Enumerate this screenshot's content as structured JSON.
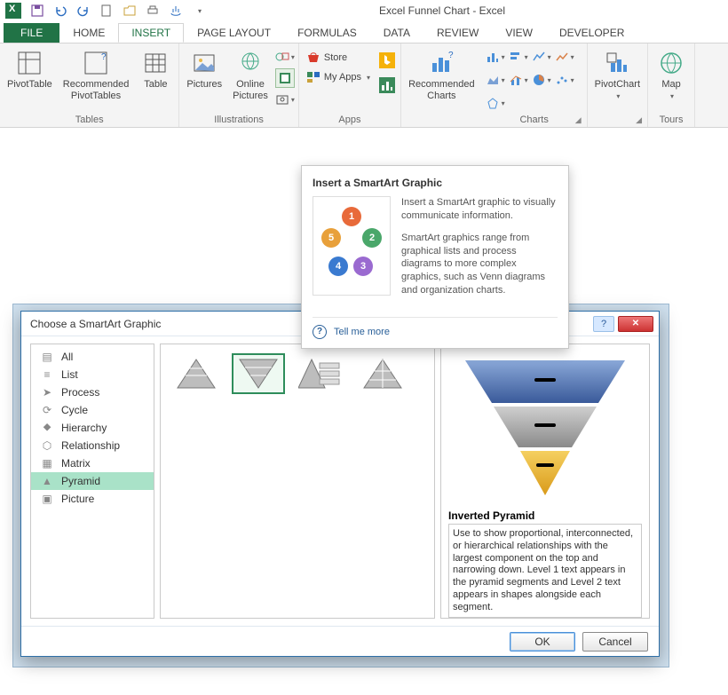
{
  "window": {
    "title": "Excel Funnel Chart - Excel"
  },
  "qat_icons": [
    "excel-logo",
    "save",
    "undo",
    "redo",
    "new",
    "open",
    "print",
    "touch",
    "customize"
  ],
  "tabs": [
    "FILE",
    "HOME",
    "INSERT",
    "PAGE LAYOUT",
    "FORMULAS",
    "DATA",
    "REVIEW",
    "VIEW",
    "DEVELOPER"
  ],
  "active_tab": "INSERT",
  "ribbon": {
    "groups": [
      {
        "name": "Tables",
        "items": [
          "PivotTable",
          "Recommended\nPivotTables",
          "Table"
        ]
      },
      {
        "name": "Illustrations",
        "items": [
          "Pictures",
          "Online\nPictures"
        ],
        "minis": [
          "shapes",
          "smartart",
          "screenshot"
        ]
      },
      {
        "name": "Apps",
        "rows": [
          "Store",
          "My Apps"
        ]
      },
      {
        "name": "",
        "items": [
          "Recommended\nCharts"
        ]
      },
      {
        "name": "Charts",
        "minis_grid": true
      },
      {
        "name": "",
        "items": [
          "PivotChart"
        ]
      },
      {
        "name": "Tours",
        "items": [
          "Map"
        ]
      }
    ]
  },
  "tooltip": {
    "title": "Insert a SmartArt Graphic",
    "p1": "Insert a SmartArt graphic to visually communicate information.",
    "p2": "SmartArt graphics range from graphical lists and process diagrams to more complex graphics, such as Venn diagrams and organization charts.",
    "tell_more": "Tell me more",
    "cycle_labels": [
      "1",
      "2",
      "3",
      "4",
      "5"
    ]
  },
  "dialog": {
    "title": "Choose a SmartArt Graphic",
    "categories": [
      "All",
      "List",
      "Process",
      "Cycle",
      "Hierarchy",
      "Relationship",
      "Matrix",
      "Pyramid",
      "Picture"
    ],
    "selected_category": "Pyramid",
    "thumbs": [
      "basic-pyramid",
      "inverted-pyramid",
      "pyramid-list",
      "segmented-pyramid"
    ],
    "selected_thumb": 1,
    "preview_title": "Inverted Pyramid",
    "preview_desc": "Use to show proportional, interconnected, or hierarchical relationships with the largest component on the top and narrowing down. Level 1 text appears in the pyramid segments and Level 2 text appears in shapes alongside each segment.",
    "ok": "OK",
    "cancel": "Cancel"
  }
}
